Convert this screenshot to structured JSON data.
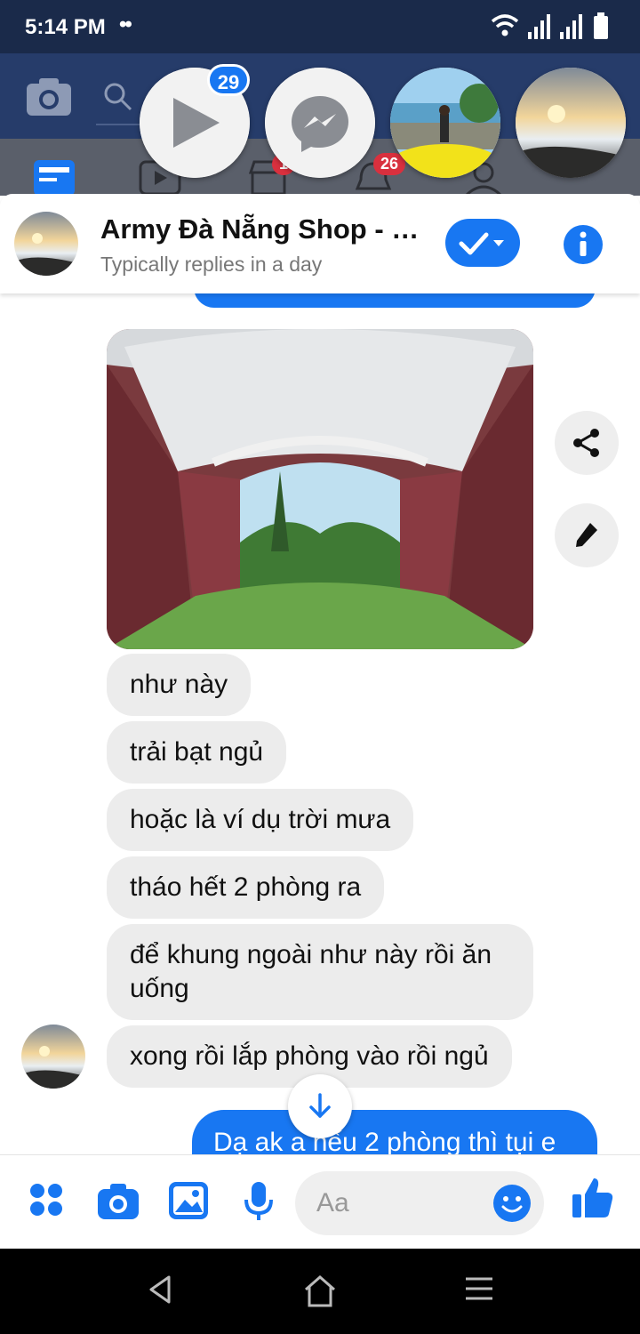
{
  "status_bar": {
    "time": "5:14 PM",
    "dots": "••"
  },
  "fb": {
    "tab_badge_1": "1",
    "tab_badge_2": "26"
  },
  "chat_heads": {
    "badge": "29"
  },
  "chat": {
    "contact_name": "Army Đà Nẵng Shop - C...",
    "subtitle": "Typically replies in a day"
  },
  "messages": [
    {
      "text": "như này",
      "from": "them"
    },
    {
      "text": "trải bạt ngủ",
      "from": "them"
    },
    {
      "text": "hoặc là ví dụ trời mưa",
      "from": "them"
    },
    {
      "text": "tháo hết 2 phòng ra",
      "from": "them"
    },
    {
      "text": "để khung ngoài như này rồi ăn uống",
      "from": "them"
    },
    {
      "text": "xong rồi lắp phòng vào rồi ngủ",
      "from": "them"
    },
    {
      "text": "Dạ ak a nếu 2 phòng thì tụi e",
      "from": "me"
    }
  ],
  "composer": {
    "placeholder": "Aa"
  },
  "colors": {
    "accent": "#1877f2",
    "fb_header": "#263c6a",
    "bubble_gray": "#ececec"
  }
}
